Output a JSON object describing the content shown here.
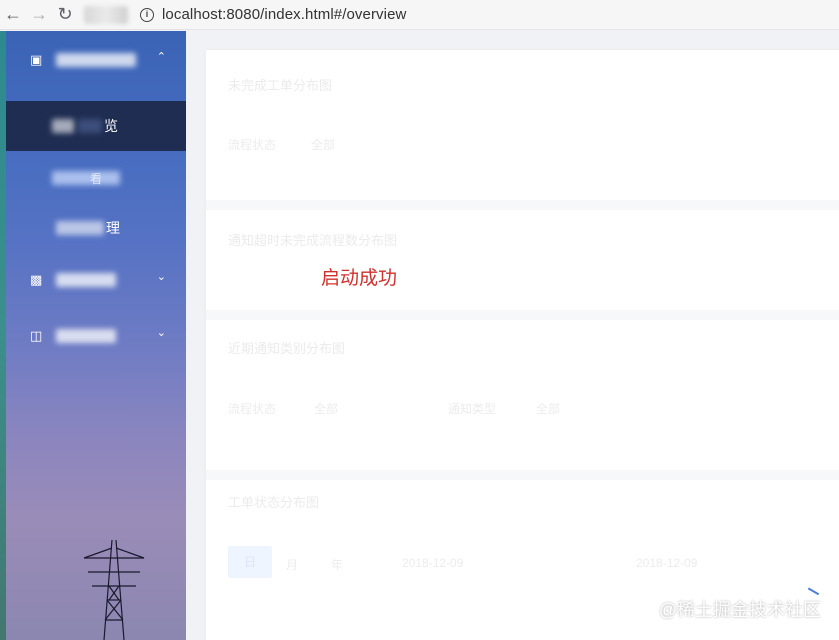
{
  "browser": {
    "back_icon": "arrow-left",
    "forward_icon": "arrow-right",
    "reload_icon": "reload",
    "url": "localhost:8080/index.html#/overview"
  },
  "sidebar": {
    "groups": [
      {
        "icon": "doc-icon",
        "label": "",
        "expanded": true
      },
      {
        "icon": "chart-icon",
        "label": "",
        "expanded": false
      },
      {
        "icon": "db-icon",
        "label": "",
        "expanded": false
      }
    ],
    "items": [
      {
        "label": "览",
        "active": true
      },
      {
        "label": "看",
        "active": false
      },
      {
        "label": "理",
        "active": false
      }
    ],
    "group2_label_partial": "明细统计"
  },
  "main": {
    "cards": [
      {
        "title": "未完成工单分布图",
        "field_label": "流程状态",
        "field_value": "全部"
      },
      {
        "title": "通知超时未完成流程数分布图"
      },
      {
        "title": "近期通知类别分布图",
        "field_label": "流程状态",
        "field_value": "全部",
        "field2_label": "通知类型",
        "field2_value": "全部"
      },
      {
        "title": "工单状态分布图",
        "buttons": [
          "日",
          "月",
          "年"
        ],
        "date_from": "2018-12-09",
        "date_to": "2018-12-09"
      }
    ]
  },
  "toast": {
    "text": "启动成功"
  },
  "watermark": {
    "text": "@稀土掘金技术社区"
  }
}
